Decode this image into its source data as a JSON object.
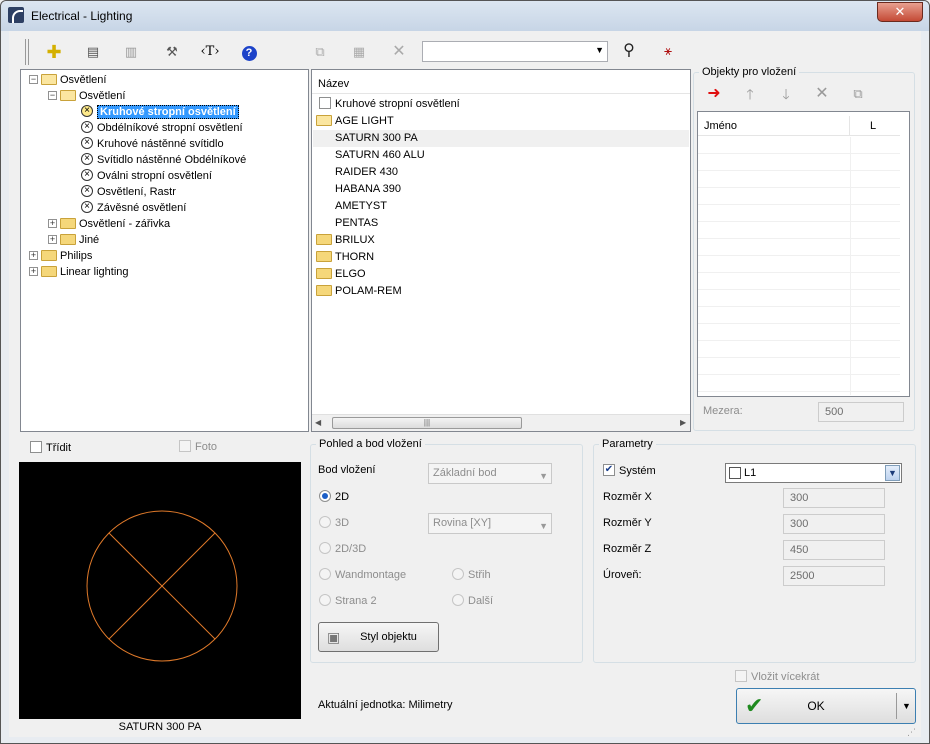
{
  "window": {
    "title": "Electrical - Lighting",
    "close_glyph": "✕"
  },
  "toolbar": {
    "search_value": ""
  },
  "tree": [
    {
      "label": "Osvětlení",
      "level": 0,
      "type": "folder",
      "expanded": true
    },
    {
      "label": "Osvětlení",
      "level": 1,
      "type": "folder",
      "expanded": true
    },
    {
      "label": "Kruhové stropní osvětlení",
      "level": 2,
      "type": "lamp",
      "selected": true
    },
    {
      "label": "Obdélníkové stropní osvětlení",
      "level": 2,
      "type": "lamp"
    },
    {
      "label": "Kruhové nástěnné svítidlo",
      "level": 2,
      "type": "lamp"
    },
    {
      "label": "Svítidlo nástěnné Obdélníkové",
      "level": 2,
      "type": "lamp"
    },
    {
      "label": "Oválni stropní osvětlení",
      "level": 2,
      "type": "lamp"
    },
    {
      "label": "Osvětlení, Rastr",
      "level": 2,
      "type": "lamp"
    },
    {
      "label": "Závěsné osvětlení",
      "level": 2,
      "type": "lamp"
    },
    {
      "label": "Osvětlení - zářivka",
      "level": 1,
      "type": "folder",
      "expanded": false
    },
    {
      "label": "Jiné",
      "level": 1,
      "type": "folder",
      "expanded": false
    },
    {
      "label": "Philips",
      "level": 0,
      "type": "folder",
      "expanded": false
    },
    {
      "label": "Linear lighting",
      "level": 0,
      "type": "folder",
      "expanded": false
    }
  ],
  "list": {
    "header": "Název",
    "items": [
      {
        "label": "Kruhové stropní osvětlení",
        "type": "check"
      },
      {
        "label": "AGE LIGHT",
        "type": "folder-open"
      },
      {
        "label": "SATURN 300 PA",
        "type": "item",
        "selected": true
      },
      {
        "label": "SATURN 460 ALU",
        "type": "item"
      },
      {
        "label": "RAIDER 430",
        "type": "item"
      },
      {
        "label": "HABANA 390",
        "type": "item"
      },
      {
        "label": "AMETYST",
        "type": "item"
      },
      {
        "label": "PENTAS",
        "type": "item"
      },
      {
        "label": "BRILUX",
        "type": "folder"
      },
      {
        "label": "THORN",
        "type": "folder"
      },
      {
        "label": "ELGO",
        "type": "folder"
      },
      {
        "label": "POLAM-REM",
        "type": "folder"
      }
    ]
  },
  "insert_panel": {
    "title": "Objekty pro vložení",
    "col_name": "Jméno",
    "col_l": "L",
    "gap_label": "Mezera:",
    "gap_value": "500"
  },
  "sort_label": "Třídit",
  "photo_label": "Foto",
  "preview_caption": "SATURN 300 PA",
  "view_group": {
    "title": "Pohled a bod vložení",
    "insert_point_label": "Bod vložení",
    "insert_point_value": "Základní bod",
    "radio_2d": "2D",
    "radio_3d": "3D",
    "radio_2d3d": "2D/3D",
    "plane_value": "Rovina  [XY]",
    "radio_wand": "Wandmontage",
    "radio_strana": "Strana 2",
    "radio_strih": "Střih",
    "radio_dalsi": "Další",
    "style_button": "Styl objektu"
  },
  "params": {
    "title": "Parametry",
    "system_label": "Systém",
    "system_value": "L1",
    "rows": [
      {
        "label": "Rozměr X",
        "value": "300"
      },
      {
        "label": "Rozměr Y",
        "value": "300"
      },
      {
        "label": "Rozměr Z",
        "value": "450"
      },
      {
        "label": "Úroveň:",
        "value": "2500"
      }
    ]
  },
  "insert_multiple": "Vložit vícekrát",
  "current_unit": "Aktuální jednotka: Milimetry",
  "ok_label": "OK",
  "colors": {
    "preview_stroke": "#e07a2a",
    "selection": "#3399ff"
  }
}
